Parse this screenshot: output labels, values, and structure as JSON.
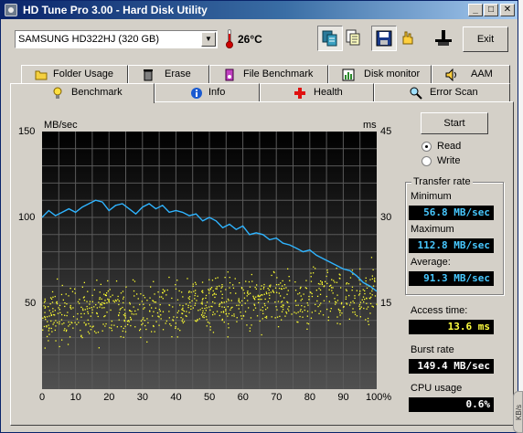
{
  "window": {
    "title": "HD Tune Pro 3.00 - Hard Disk Utility"
  },
  "toolbar": {
    "drive": "SAMSUNG HD322HJ (320 GB)",
    "temperature": "26°C",
    "exit_label": "Exit",
    "buttons": [
      "copy-info-icon",
      "copy-text-icon",
      "save-screenshot-icon",
      "options-icon",
      "disk-manager-icon"
    ]
  },
  "tabs": {
    "row1": [
      {
        "label": "Folder Usage",
        "icon": "folder-icon"
      },
      {
        "label": "Erase",
        "icon": "trash-icon"
      },
      {
        "label": "File Benchmark",
        "icon": "file-benchmark-icon"
      },
      {
        "label": "Disk monitor",
        "icon": "disk-monitor-icon"
      },
      {
        "label": "AAM",
        "icon": "speaker-icon"
      }
    ],
    "row2": [
      {
        "label": "Benchmark",
        "icon": "lightbulb-icon",
        "active": true
      },
      {
        "label": "Info",
        "icon": "info-icon"
      },
      {
        "label": "Health",
        "icon": "health-cross-icon"
      },
      {
        "label": "Error Scan",
        "icon": "magnifier-icon"
      }
    ]
  },
  "controls": {
    "start_label": "Start",
    "read_label": "Read",
    "write_label": "Write",
    "selected_mode": "Read"
  },
  "transfer": {
    "group_title": "Transfer rate",
    "minimum_label": "Minimum",
    "minimum_value": "56.8 MB/sec",
    "maximum_label": "Maximum",
    "maximum_value": "112.8 MB/sec",
    "average_label": "Average:",
    "average_value": "91.3 MB/sec"
  },
  "stats": {
    "access_label": "Access time:",
    "access_value": "13.6 ms",
    "burst_label": "Burst rate",
    "burst_value": "149.4 MB/sec",
    "cpu_label": "CPU usage",
    "cpu_value": "0.6%"
  },
  "side_tab": "KB/s",
  "chart_data": {
    "type": "line",
    "left_unit": "MB/sec",
    "right_unit": "ms",
    "left_ticks": [
      "150",
      "100",
      "50"
    ],
    "right_ticks": [
      "45",
      "30",
      "15"
    ],
    "x_ticks": [
      "0",
      "10",
      "20",
      "30",
      "40",
      "50",
      "60",
      "70",
      "80",
      "90",
      "100%"
    ],
    "xlim": [
      0,
      100
    ],
    "ylim_left": [
      0,
      150
    ],
    "ylim_right": [
      0,
      45
    ],
    "grid": true,
    "colors": {
      "transfer": "#2fb4ff",
      "access": "#ffff30",
      "background_top": "#000000",
      "background_bottom": "#505050",
      "grid": "#5a5a5a"
    },
    "series": [
      {
        "name": "Transfer rate (MB/sec)",
        "axis": "left",
        "x": [
          0,
          2,
          4,
          6,
          8,
          10,
          12,
          14,
          16,
          18,
          20,
          22,
          24,
          26,
          28,
          30,
          32,
          34,
          36,
          38,
          40,
          42,
          44,
          46,
          48,
          50,
          52,
          54,
          56,
          58,
          60,
          62,
          64,
          66,
          68,
          70,
          72,
          74,
          76,
          78,
          80,
          82,
          84,
          86,
          88,
          90,
          92,
          94,
          96,
          98,
          100
        ],
        "y": [
          100,
          104,
          101,
          103,
          105,
          103,
          106,
          108,
          110,
          109,
          104,
          107,
          108,
          105,
          102,
          106,
          108,
          105,
          107,
          103,
          104,
          103,
          101,
          102,
          98,
          100,
          98,
          94,
          96,
          93,
          95,
          90,
          91,
          90,
          87,
          88,
          85,
          84,
          82,
          80,
          81,
          78,
          76,
          74,
          72,
          70,
          69,
          66,
          62,
          60,
          57
        ]
      },
      {
        "name": "Access time (ms)",
        "axis": "right",
        "type": "scatter",
        "approximate_range_ms": [
          6,
          24
        ],
        "typical_ms": 12
      }
    ]
  }
}
